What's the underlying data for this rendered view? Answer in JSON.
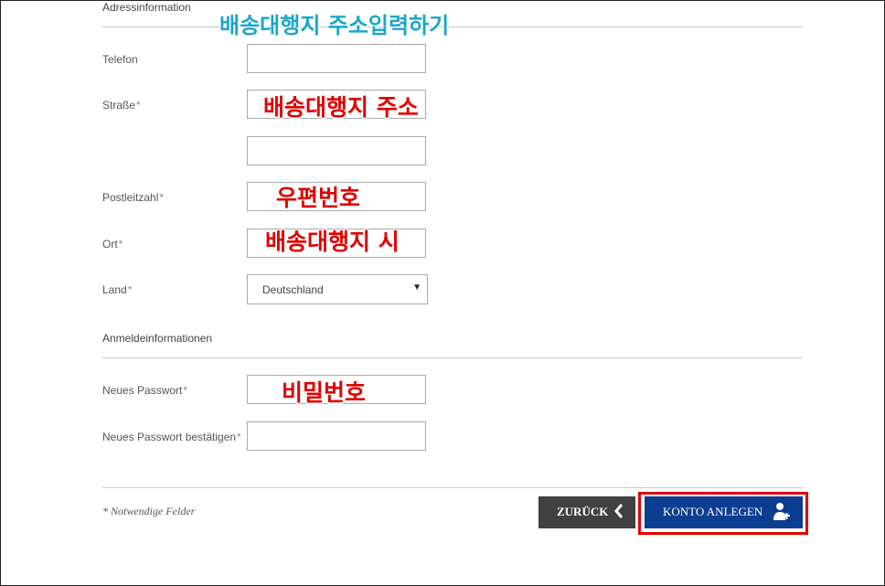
{
  "address_section": {
    "title": "Adressinformation",
    "overlay": "배송대행지 주소입력하기"
  },
  "fields": {
    "telefon": {
      "label": "Telefon",
      "value": ""
    },
    "strasse": {
      "label": "Straße",
      "required": "*",
      "overlay": "배송대행지 주소",
      "value": ""
    },
    "strasse2": {
      "value": ""
    },
    "plz": {
      "label": "Postleitzahl",
      "required": "*",
      "overlay": "우편번호",
      "value": ""
    },
    "ort": {
      "label": "Ort",
      "required": "*",
      "overlay": "배송대행지 시",
      "value": ""
    },
    "land": {
      "label": "Land",
      "required": "*",
      "selected": "Deutschland"
    }
  },
  "login_section": {
    "title": "Anmeldeinformationen",
    "password": {
      "label": "Neues Passwort",
      "required": "*",
      "overlay": "비밀번호",
      "value": ""
    },
    "password_confirm": {
      "label": "Neues Passwort bestätigen",
      "required": "*",
      "value": ""
    }
  },
  "footer": {
    "required_note": "* Notwendige Felder",
    "back_label": "ZURÜCK",
    "back_icon": "chevron-left-icon",
    "create_label": "KONTO ANLEGEN",
    "create_icon": "add-user-icon",
    "highlight_color": "#e00000",
    "primary_color": "#0b3d91"
  }
}
